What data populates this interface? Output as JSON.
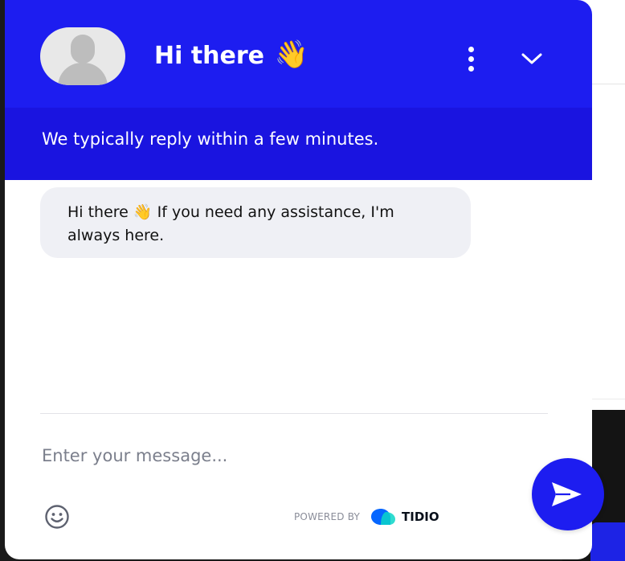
{
  "header": {
    "title": "Hi there",
    "title_emoji": "👋",
    "subtitle": "We typically reply within a few minutes.",
    "avatar_icon": "user-placeholder-icon",
    "menu_icon": "kebab-menu-icon",
    "collapse_icon": "chevron-down-icon"
  },
  "messages": [
    {
      "sender": "operator",
      "text_before_emoji": "Hi there ",
      "emoji": "👋",
      "text_after_emoji": " If you need any assistance, I'm always here."
    }
  ],
  "composer": {
    "placeholder": "Enter your message...",
    "emoji_icon": "smiley-icon",
    "send_icon": "send-arrow-icon"
  },
  "footer": {
    "powered_by": "POWERED BY",
    "brand": "TIDIO"
  },
  "colors": {
    "accent": "#1d1df0",
    "bubble_bg": "#eff0f5",
    "placeholder": "#7b7f8c"
  }
}
